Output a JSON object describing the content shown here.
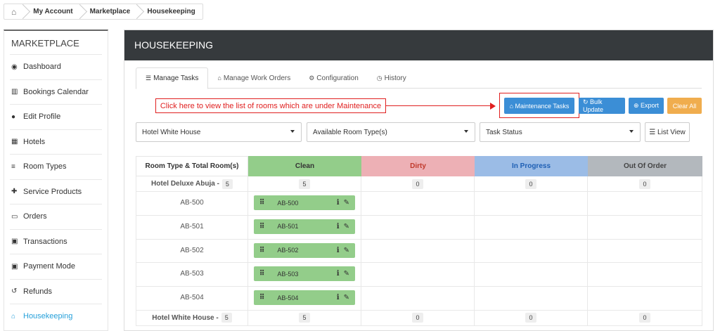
{
  "breadcrumb": {
    "home_icon": "home-icon",
    "items": [
      "My Account",
      "Marketplace",
      "Housekeeping"
    ]
  },
  "sidebar": {
    "title": "MARKETPLACE",
    "items": [
      {
        "label": "Dashboard",
        "icon": "dashboard-icon",
        "glyph": "◉"
      },
      {
        "label": "Bookings Calendar",
        "icon": "bar-chart-icon",
        "glyph": "▥"
      },
      {
        "label": "Edit Profile",
        "icon": "user-icon",
        "glyph": "●"
      },
      {
        "label": "Hotels",
        "icon": "building-icon",
        "glyph": "▦"
      },
      {
        "label": "Room Types",
        "icon": "bed-icon",
        "glyph": "≡"
      },
      {
        "label": "Service Products",
        "icon": "users-plus-icon",
        "glyph": "✚"
      },
      {
        "label": "Orders",
        "icon": "credit-card-icon",
        "glyph": "▭"
      },
      {
        "label": "Transactions",
        "icon": "money-icon",
        "glyph": "▣"
      },
      {
        "label": "Payment Mode",
        "icon": "money-icon",
        "glyph": "▣"
      },
      {
        "label": "Refunds",
        "icon": "undo-icon",
        "glyph": "↺"
      },
      {
        "label": "Housekeeping",
        "icon": "home-icon",
        "glyph": "⌂"
      }
    ],
    "active_index": 10,
    "active_color": "#26a0da"
  },
  "panel": {
    "title": "HOUSEKEEPING",
    "tabs": [
      {
        "label": "Manage Tasks",
        "glyph": "☰"
      },
      {
        "label": "Manage Work Orders",
        "glyph": "⌂"
      },
      {
        "label": "Configuration",
        "glyph": "⚙"
      },
      {
        "label": "History",
        "glyph": "◷"
      }
    ],
    "annotation": "Click here to view the list of rooms which are under Maintenance",
    "buttons": {
      "maintenance": "⌂ Maintenance Tasks",
      "bulk_update": "↻ Bulk Update",
      "export": "⊕ Export",
      "clear_all": "Clear All"
    },
    "filters": {
      "hotel": "Hotel White House",
      "room_type": "Available Room Type(s)",
      "task_status": "Task Status",
      "list_view": "☰ List View"
    }
  },
  "table": {
    "headers": [
      "Room Type & Total Room(s)",
      "Clean",
      "Dirty",
      "In Progress",
      "Out Of Order"
    ],
    "groups": [
      {
        "name": "Hotel Deluxe Abuja -",
        "total": "5",
        "counts": [
          "5",
          "0",
          "0",
          "0"
        ],
        "rooms": [
          "AB-500",
          "AB-501",
          "AB-502",
          "AB-503",
          "AB-504"
        ]
      },
      {
        "name": "Hotel White House -",
        "total": "5",
        "counts": [
          "5",
          "0",
          "0",
          "0"
        ]
      }
    ]
  },
  "colors": {
    "header_bg": "#363a3d",
    "clean": "#93cd8a",
    "dirty": "#edb0b5",
    "in_progress": "#9bbce6",
    "out_of_order": "#b3b8bd",
    "annotation": "#e02020",
    "button_blue": "#3b8ed6",
    "button_orange": "#f0ad4e"
  }
}
